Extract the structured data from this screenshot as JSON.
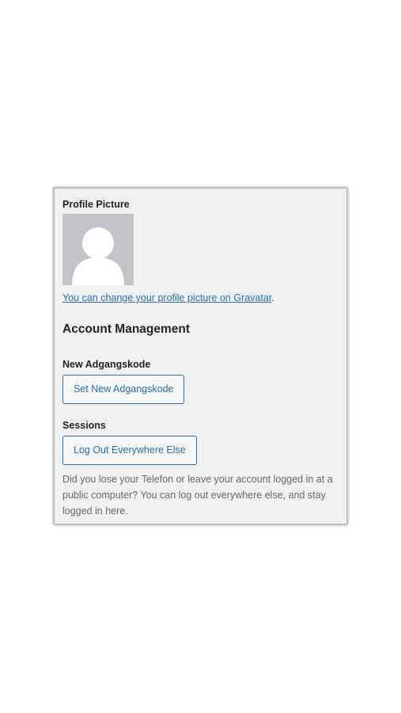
{
  "profile": {
    "picture_label": "Profile Picture",
    "gravatar_link": "You can change your profile picture on Gravatar",
    "gravatar_suffix": "."
  },
  "account": {
    "title": "Account Management",
    "password_label": "New Adgangskode",
    "password_button": "Set New Adgangskode",
    "sessions_label": "Sessions",
    "logout_button": "Log Out Everywhere Else",
    "sessions_description": "Did you lose your Telefon or leave your account logged in at a public computer? You can log out everywhere else, and stay logged in here."
  },
  "colors": {
    "panel_background": "#f0f0f1",
    "link": "#2271b1",
    "avatar_background": "#c3c4c7"
  },
  "icons": {
    "avatar": "default-person-avatar-icon"
  }
}
